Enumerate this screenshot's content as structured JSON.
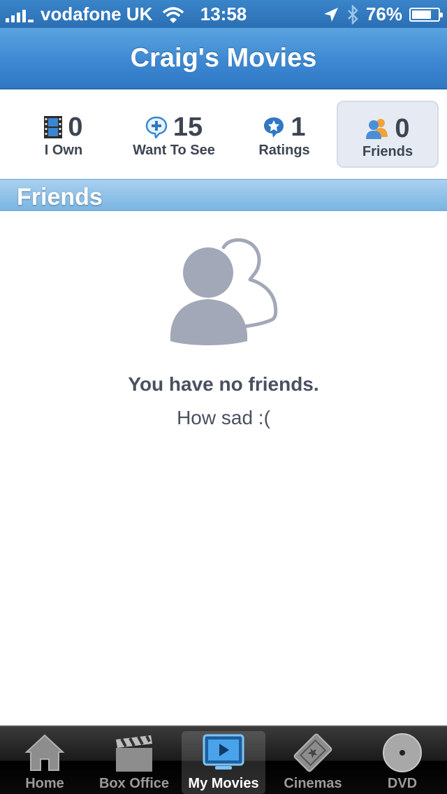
{
  "status_bar": {
    "carrier": "vodafone UK",
    "time": "13:58",
    "battery": "76%",
    "battery_level": 0.76
  },
  "nav": {
    "title": "Craig's Movies"
  },
  "stats": [
    {
      "count": "0",
      "label": "I Own",
      "icon": "film-icon"
    },
    {
      "count": "15",
      "label": "Want To See",
      "icon": "want-to-see-icon"
    },
    {
      "count": "1",
      "label": "Ratings",
      "icon": "star-badge-icon"
    },
    {
      "count": "0",
      "label": "Friends",
      "icon": "friends-icon",
      "active": true
    }
  ],
  "section": {
    "label": "Friends"
  },
  "empty_state": {
    "icon": "friends-icon",
    "title": "You have no friends.",
    "subtitle": "How sad :("
  },
  "tabbar": [
    {
      "label": "Home",
      "icon": "home-icon"
    },
    {
      "label": "Box Office",
      "icon": "clapperboard-icon"
    },
    {
      "label": "My Movies",
      "icon": "tv-play-icon",
      "active": true
    },
    {
      "label": "Cinemas",
      "icon": "ticket-icon"
    },
    {
      "label": "DVD",
      "icon": "disc-icon"
    }
  ],
  "colors": {
    "nav_blue": "#3b86d1",
    "section_blue": "#7ab5e2",
    "text_dark": "#3d4552",
    "placeholder_gray": "#a3a8b8"
  }
}
